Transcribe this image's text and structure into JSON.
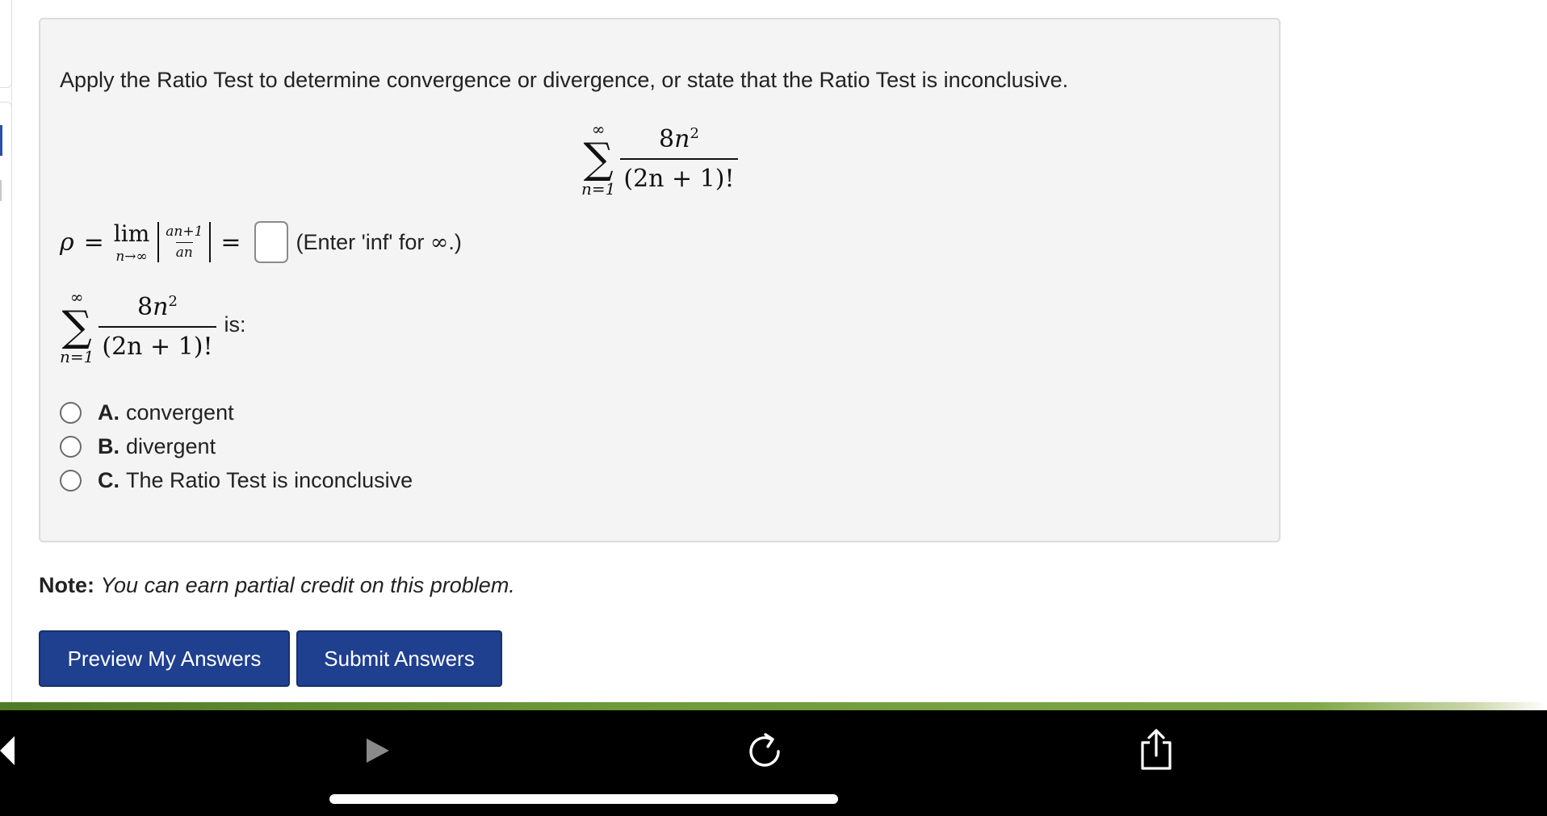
{
  "problem": {
    "prompt": "Apply the Ratio Test to determine convergence or divergence, or state that the Ratio Test is inconclusive.",
    "series": {
      "upper": "∞",
      "lower": "n=1",
      "numerator_coef": "8",
      "numerator_var": "n",
      "numerator_exp": "2",
      "denominator": "(2n + 1)!"
    },
    "rho_symbol": "ρ",
    "equals": "=",
    "lim_word": "lim",
    "lim_sub": "n→∞",
    "ratio_num": "an+1",
    "ratio_den": "an",
    "answer_value": "",
    "hint": "(Enter 'inf' for ",
    "hint_inf": "∞",
    "hint_end": ".)",
    "is_label": "is:",
    "options": [
      {
        "letter": "A.",
        "text": "convergent"
      },
      {
        "letter": "B.",
        "text": "divergent"
      },
      {
        "letter": "C.",
        "text": "The Ratio Test is inconclusive"
      }
    ]
  },
  "note": {
    "label": "Note:",
    "text": "You can earn partial credit on this problem."
  },
  "buttons": {
    "preview": "Preview My Answers",
    "submit": "Submit Answers"
  },
  "toolbar": {
    "icons": [
      "back-icon",
      "forward-icon",
      "reload-icon",
      "share-icon"
    ]
  }
}
